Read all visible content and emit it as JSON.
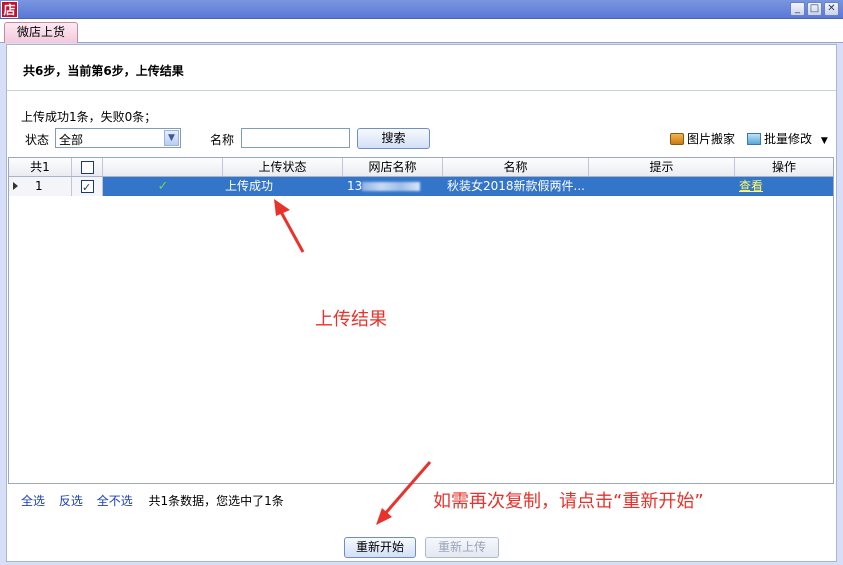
{
  "window": {
    "app_icon_text": "店",
    "controls": {
      "minimize": "_",
      "maximize": "□",
      "close": "✕"
    }
  },
  "tabs": [
    {
      "label": "微店上货"
    }
  ],
  "steps": {
    "text": "共6步，当前第6步，上传结果"
  },
  "summary": {
    "text": "上传成功1条，失败0条；"
  },
  "filters": {
    "status_label": "状态",
    "status_value": "全部",
    "name_label": "名称",
    "name_value": "",
    "search_button": "搜索"
  },
  "tools": {
    "image_move": "图片搬家",
    "batch_edit": "批量修改"
  },
  "grid": {
    "headers": {
      "count": "共1",
      "upload_status": "上传状态",
      "shop_name": "网店名称",
      "name": "名称",
      "hint": "提示",
      "action": "操作"
    },
    "rows": [
      {
        "index": "1",
        "checked": true,
        "status": "上传成功",
        "shop_name_prefix": "13",
        "name": "秋装女2018新款假两件...",
        "hint": "",
        "action": "查看"
      }
    ]
  },
  "annotations": {
    "result": "上传结果",
    "restart_hint": "如需再次复制，请点击“重新开始”"
  },
  "footer": {
    "select_all": "全选",
    "invert": "反选",
    "select_none": "全不选",
    "count_text": "共1条数据，您选中了1条"
  },
  "buttons": {
    "restart": "重新开始",
    "reupload": "重新上传"
  },
  "colors": {
    "selection": "#3375c9",
    "annotation": "#e8322b",
    "link": "#1a3fbf"
  }
}
